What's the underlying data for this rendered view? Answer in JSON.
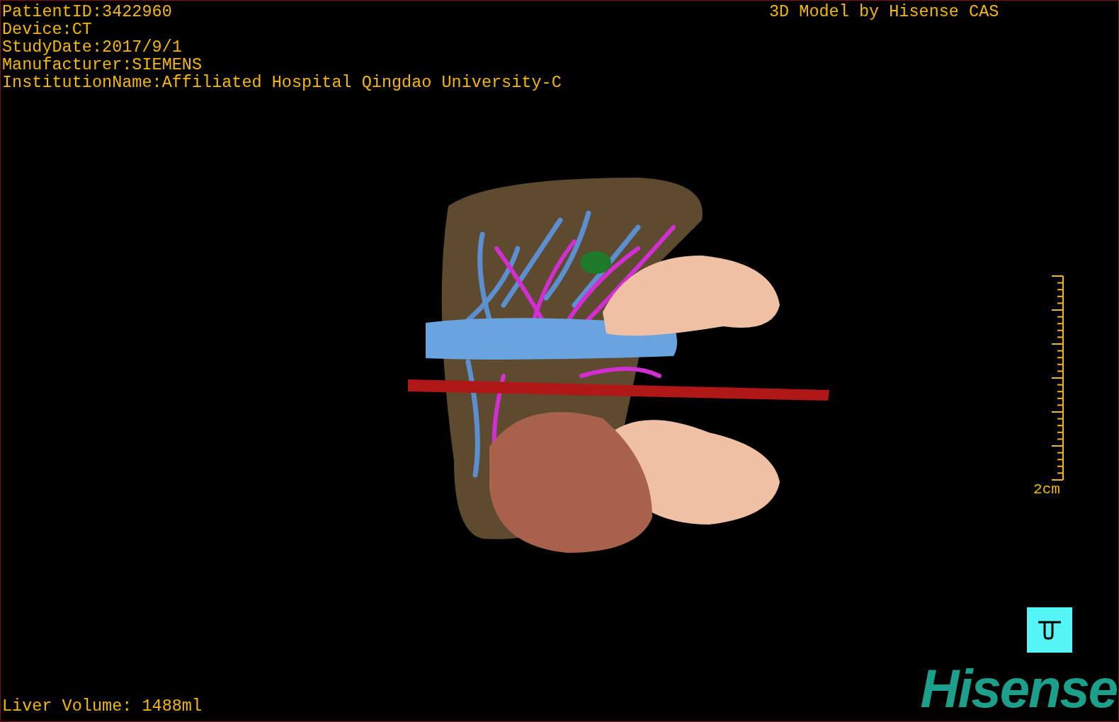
{
  "info_lines": [
    "PatientID:3422960",
    "Device:CT",
    "StudyDate:2017/9/1",
    "Manufacturer:SIEMENS",
    "InstitutionName:Affiliated Hospital Qingdao University-C"
  ],
  "model_title": "3D Model by Hisense CAS",
  "scale_bar": {
    "label": "2cm"
  },
  "liver_volume": "Liver Volume: 1488ml",
  "logo": {
    "text": "Hisense"
  }
}
